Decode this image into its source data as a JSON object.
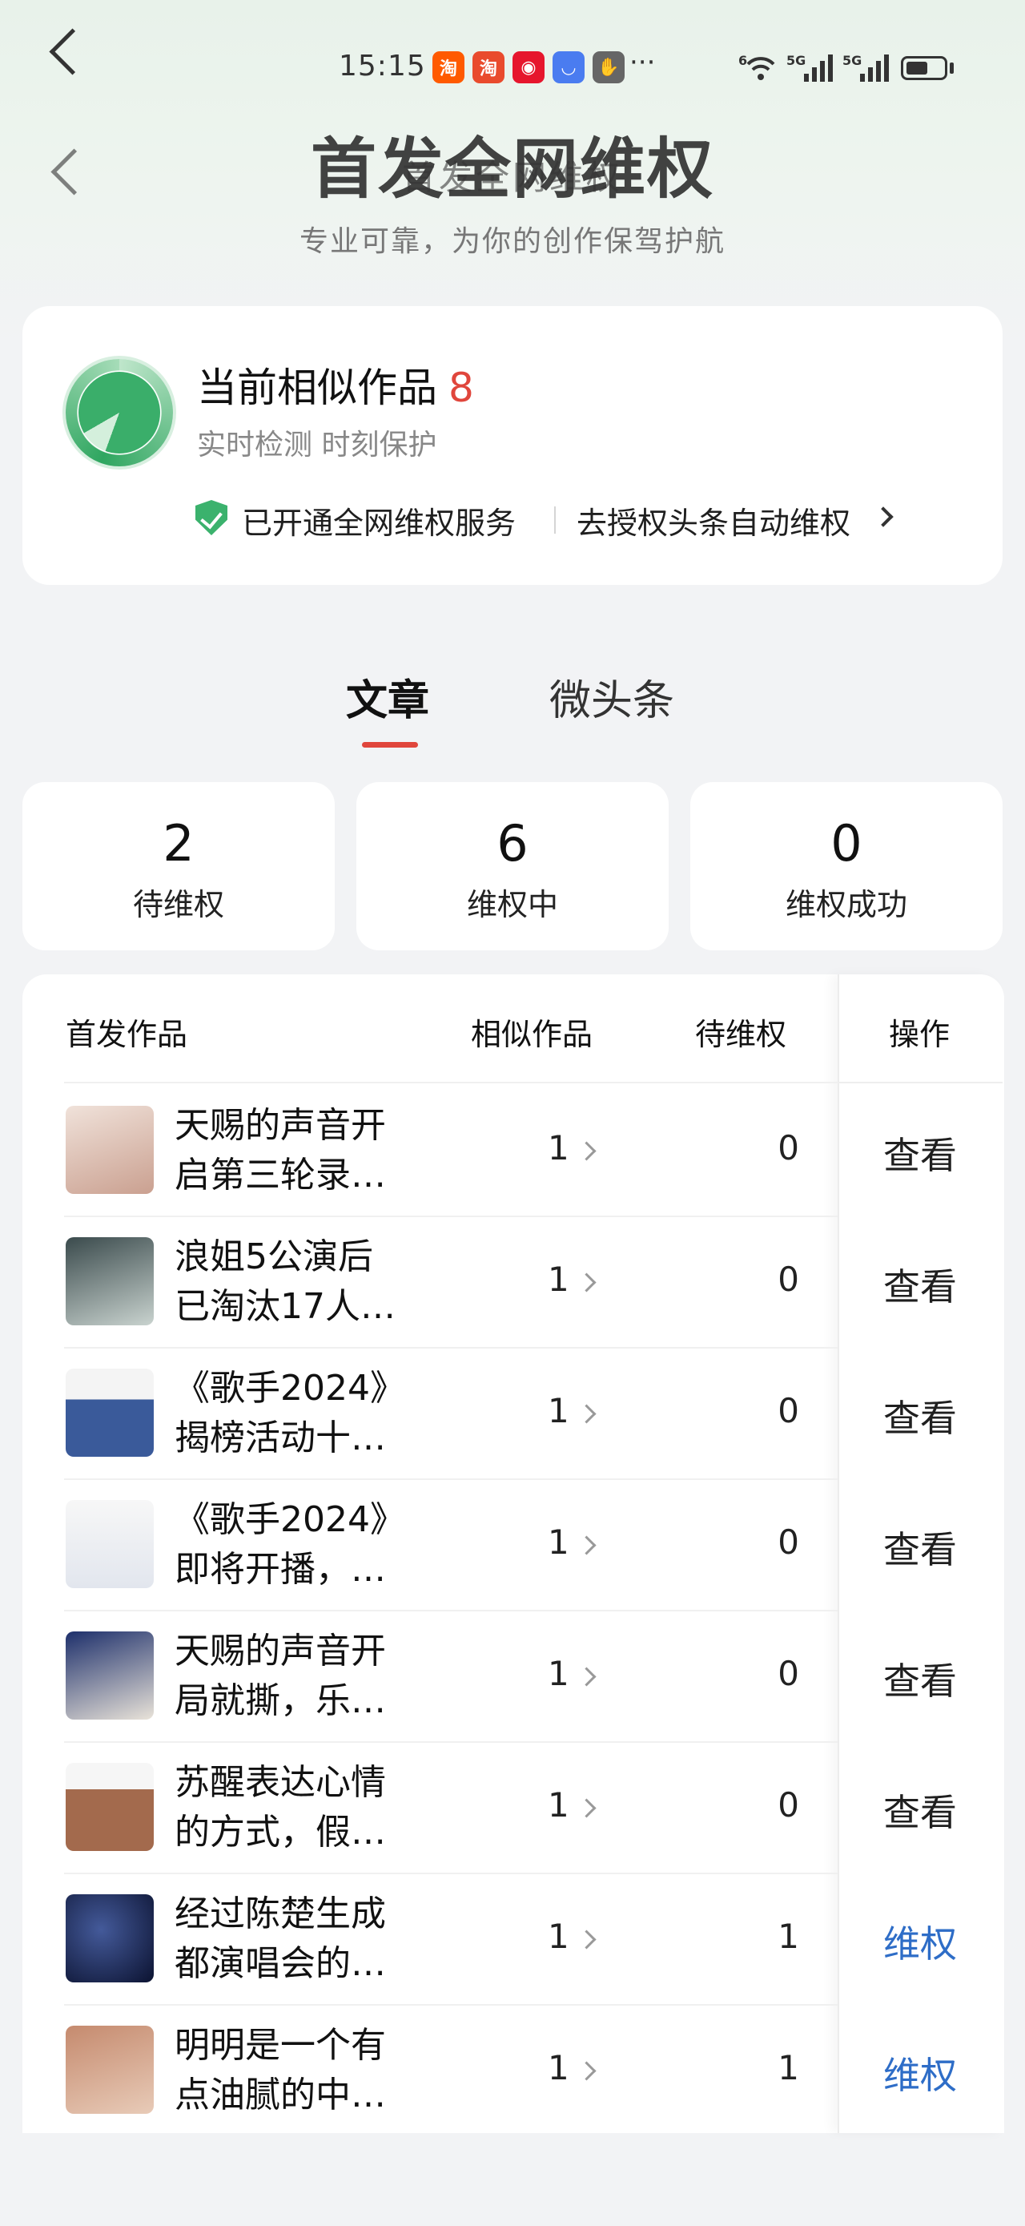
{
  "status": {
    "time": "15:15",
    "network1": "5G",
    "network2": "5G",
    "wifi_label": "6"
  },
  "app_icons": [
    {
      "name": "taobao",
      "glyph": "淘",
      "color": "#ff5a00"
    },
    {
      "name": "taobao-alt",
      "glyph": "淘",
      "color": "#e94b2d"
    },
    {
      "name": "weibo",
      "glyph": "◉",
      "color": "#e6162d"
    },
    {
      "name": "app-blue",
      "glyph": "◡",
      "color": "#4a7cf0"
    },
    {
      "name": "app-hand",
      "glyph": "✋",
      "color": "#666666"
    }
  ],
  "header": {
    "title": "首发全网维权",
    "title_ghost": "首发全网维权",
    "subtitle": "专业可靠，为你的创作保驾护航"
  },
  "summary": {
    "label": "当前相似作品",
    "count": "8",
    "sub": "实时检测 时刻保护",
    "service_text": "已开通全网维权服务",
    "auth_link": "去授权头条自动维权"
  },
  "tabs": [
    {
      "label": "文章",
      "active": true
    },
    {
      "label": "微头条",
      "active": false
    }
  ],
  "stats": [
    {
      "value": "2",
      "label": "待维权"
    },
    {
      "value": "6",
      "label": "维权中"
    },
    {
      "value": "0",
      "label": "维权成功"
    }
  ],
  "table": {
    "headers": {
      "work": "首发作品",
      "similar": "相似作品",
      "pending": "待维权",
      "action": "操作"
    },
    "rows": [
      {
        "line1": "天赐的声音开",
        "line2": "启第三轮录…",
        "similar": "1",
        "pending": "0",
        "action": "查看",
        "action_color": "#1f1f1f",
        "thumb_bg": "linear-gradient(160deg,#f0e2da,#caa090)"
      },
      {
        "line1": "浪姐5公演后",
        "line2": "已淘汰17人…",
        "similar": "1",
        "pending": "0",
        "action": "查看",
        "action_color": "#1f1f1f",
        "thumb_bg": "linear-gradient(160deg,#3a4a4c,#c9d3cf)"
      },
      {
        "line1": "《歌手2024》",
        "line2": "揭榜活动十…",
        "similar": "1",
        "pending": "0",
        "action": "查看",
        "action_color": "#1f1f1f",
        "thumb_bg": "linear-gradient(180deg,#f4f4f4 0 35%,#3a5a9a 35%)"
      },
      {
        "line1": "《歌手2024》",
        "line2": "即将开播，…",
        "similar": "1",
        "pending": "0",
        "action": "查看",
        "action_color": "#1f1f1f",
        "thumb_bg": "linear-gradient(180deg,#f7f7f7,#e2e6ee)"
      },
      {
        "line1": "天赐的声音开",
        "line2": "局就撕，乐…",
        "similar": "1",
        "pending": "0",
        "action": "查看",
        "action_color": "#1f1f1f",
        "thumb_bg": "linear-gradient(160deg,#1d2f6b,#e9e3d9)"
      },
      {
        "line1": "苏醒表达心情",
        "line2": "的方式，假…",
        "similar": "1",
        "pending": "0",
        "action": "查看",
        "action_color": "#1f1f1f",
        "thumb_bg": "linear-gradient(180deg,#f6f6f6 0 30%,#a36a4d 30%)"
      },
      {
        "line1": "经过陈楚生成",
        "line2": "都演唱会的…",
        "similar": "1",
        "pending": "1",
        "action": "维权",
        "action_color": "#2e6dc7",
        "thumb_bg": "radial-gradient(circle at 40% 40%,#445a9a,#0b1230)"
      },
      {
        "line1": "明明是一个有",
        "line2": "点油腻的中…",
        "similar": "1",
        "pending": "1",
        "action": "维权",
        "action_color": "#2e6dc7",
        "thumb_bg": "linear-gradient(160deg,#c58a6e,#e8cbb8)"
      }
    ]
  }
}
